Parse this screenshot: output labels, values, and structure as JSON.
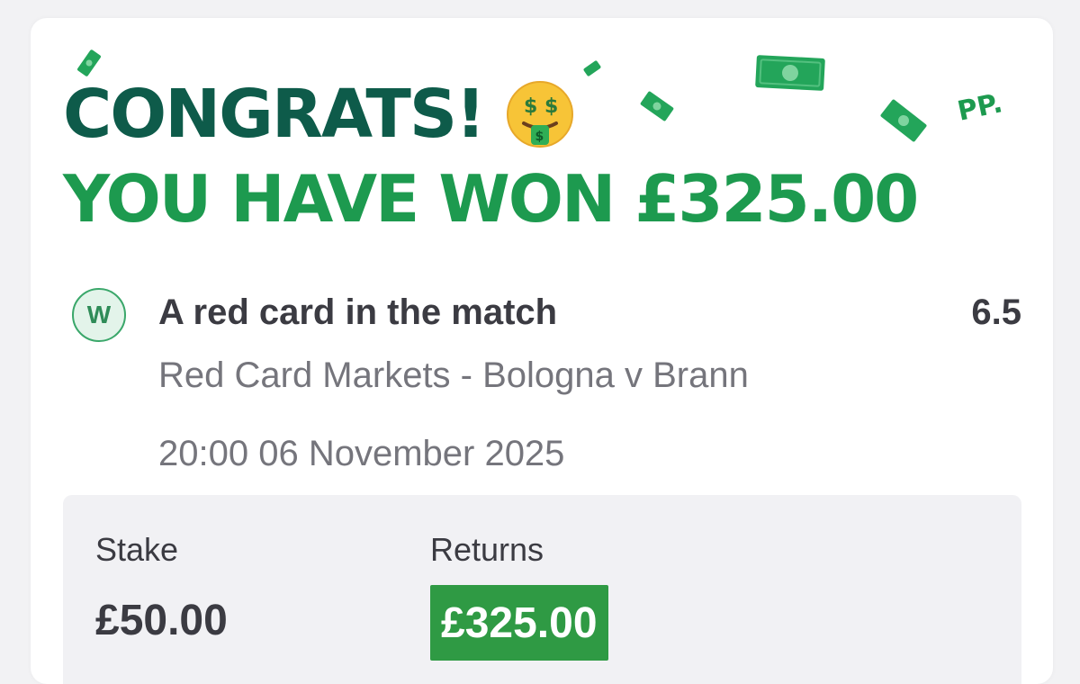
{
  "headline": {
    "congrats": "CONGRATS!",
    "won": "YOU HAVE WON £325.00",
    "brand": "PP."
  },
  "bet": {
    "result_badge": "W",
    "selection": "A red card in the match",
    "odds": "6.5",
    "market": "Red Card Markets - Bologna v Brann",
    "datetime": "20:00 06 November 2025"
  },
  "summary": {
    "stake_label": "Stake",
    "stake_value": "£50.00",
    "returns_label": "Returns",
    "returns_value": "£325.00"
  },
  "colors": {
    "congrats_text": "#0e5b4a",
    "won_text": "#1d9a4f",
    "returns_bg": "#2f9a44",
    "summary_bg": "#f1f1f4"
  },
  "icons": {
    "emoji": "money-mouth-face-icon",
    "confetti": "cash-note-icon",
    "result": "win-badge-icon"
  }
}
